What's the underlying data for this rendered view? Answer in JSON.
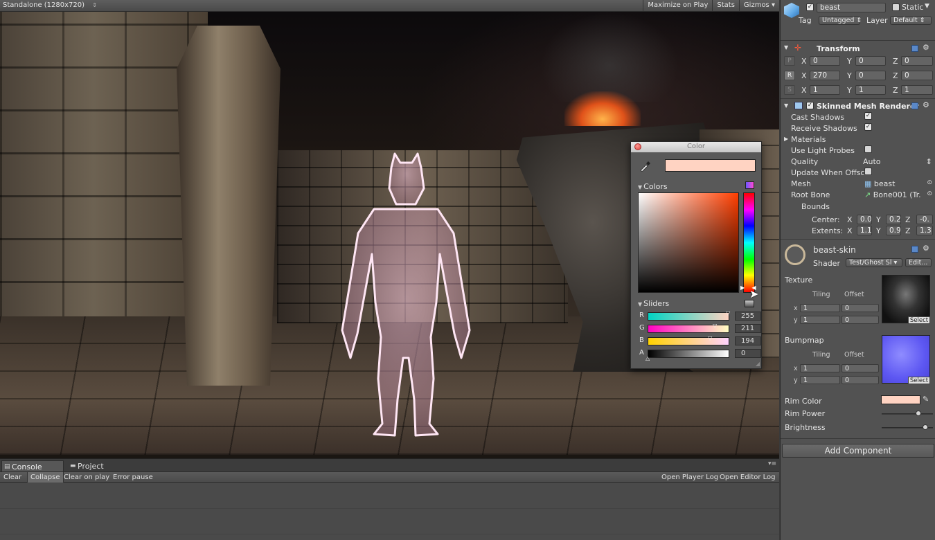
{
  "game_toolbar": {
    "resolution": "Standalone (1280x720)",
    "maximize": "Maximize on Play",
    "stats": "Stats",
    "gizmos": "Gizmos"
  },
  "color_picker": {
    "title": "Color",
    "colors_section": "Colors",
    "sliders_section": "Sliders",
    "current_color": "#ffd3c2",
    "sliders": [
      {
        "label": "R",
        "value": "255"
      },
      {
        "label": "G",
        "value": "211"
      },
      {
        "label": "B",
        "value": "194"
      },
      {
        "label": "A",
        "value": "0"
      }
    ]
  },
  "console": {
    "tabs": [
      "Console",
      "Project"
    ],
    "toolbar": {
      "clear": "Clear",
      "collapse": "Collapse",
      "clear_on_play": "Clear on play",
      "error_pause": "Error pause",
      "open_player_log": "Open Player Log",
      "open_editor_log": "Open Editor Log"
    }
  },
  "inspector": {
    "object_name": "beast",
    "static_label": "Static",
    "tag_label": "Tag",
    "tag_value": "Untagged",
    "layer_label": "Layer",
    "layer_value": "Default",
    "transform": {
      "title": "Transform",
      "rows": [
        {
          "btn": "P",
          "x": "0",
          "y": "0",
          "z": "0"
        },
        {
          "btn": "R",
          "x": "270",
          "y": "0",
          "z": "0"
        },
        {
          "btn": "S",
          "x": "1",
          "y": "1",
          "z": "1"
        }
      ],
      "axis_x": "X",
      "axis_y": "Y",
      "axis_z": "Z"
    },
    "skinned_mesh": {
      "title": "Skinned Mesh Renderer",
      "cast_shadows": "Cast Shadows",
      "receive_shadows": "Receive Shadows",
      "materials": "Materials",
      "use_light_probes": "Use Light Probes",
      "quality": "Quality",
      "quality_value": "Auto",
      "update_offscreen": "Update When Offsc",
      "mesh": "Mesh",
      "mesh_value": "beast",
      "root_bone": "Root Bone",
      "root_bone_value": "Bone001 (Tr.",
      "bounds": "Bounds",
      "center": "Center:",
      "center_vals": [
        "0.0",
        "0.2",
        "-0."
      ],
      "extents": "Extents:",
      "extents_vals": [
        "1.1",
        "0.9",
        "1.3"
      ]
    },
    "material": {
      "name": "beast-skin",
      "shader_label": "Shader",
      "shader_value": "Test/Ghost Sl",
      "edit": "Edit...",
      "texture": "Texture",
      "bumpmap": "Bumpmap",
      "tiling": "Tiling",
      "offset": "Offset",
      "x": "x",
      "y": "y",
      "tex_tiling": [
        "1",
        "1"
      ],
      "tex_offset": [
        "0",
        "0"
      ],
      "bump_tiling": [
        "1",
        "1"
      ],
      "bump_offset": [
        "0",
        "0"
      ],
      "select": "Select",
      "rim_color": "Rim Color",
      "rim_color_value": "#ffd3c2",
      "rim_power": "Rim Power",
      "rim_power_level": 0.72,
      "brightness": "Brightness",
      "brightness_level": 0.85
    },
    "add_component": "Add Component"
  }
}
